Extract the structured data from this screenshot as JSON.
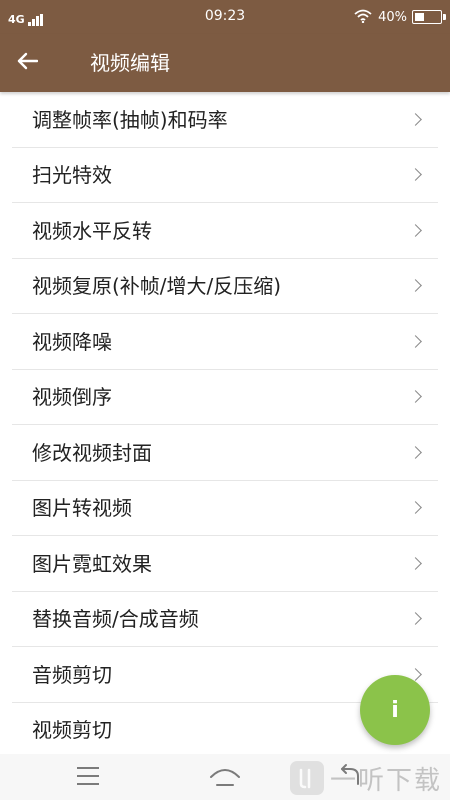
{
  "status_bar": {
    "network": "4G",
    "time": "09:23",
    "battery_percent": "40%",
    "battery_level": 0.4,
    "signal_icon": "signal-bars-icon",
    "wifi_icon": "wifi-icon"
  },
  "header": {
    "title": "视频编辑",
    "back_icon": "arrow-left-icon"
  },
  "menu": {
    "items": [
      {
        "label": "调整帧率(抽帧)和码率"
      },
      {
        "label": "扫光特效"
      },
      {
        "label": "视频水平反转"
      },
      {
        "label": "视频复原(补帧/增大/反压缩)"
      },
      {
        "label": "视频降噪"
      },
      {
        "label": "视频倒序"
      },
      {
        "label": "修改视频封面"
      },
      {
        "label": "图片转视频"
      },
      {
        "label": "图片霓虹效果"
      },
      {
        "label": "替换音频/合成音频"
      },
      {
        "label": "音频剪切"
      },
      {
        "label": "视频剪切"
      }
    ]
  },
  "fab": {
    "label": "i",
    "color": "#8bc34a"
  },
  "watermark": {
    "text": "一听下载"
  },
  "colors": {
    "primary": "#7d5b42",
    "fab": "#8bc34a",
    "text": "#222222",
    "divider": "#e6e6e6"
  }
}
